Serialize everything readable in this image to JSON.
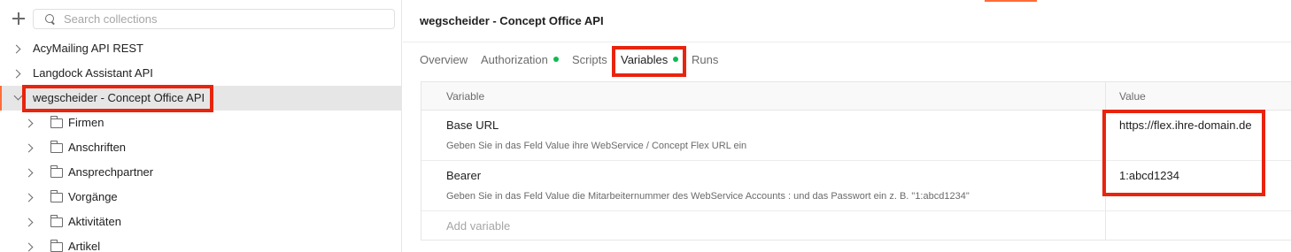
{
  "sidebar": {
    "search_placeholder": "Search collections",
    "collections": [
      {
        "label": "AcyMailing API REST"
      },
      {
        "label": "Langdock Assistant API"
      },
      {
        "label": "wegscheider - Concept Office API"
      }
    ],
    "folders": [
      {
        "label": "Firmen"
      },
      {
        "label": "Anschriften"
      },
      {
        "label": "Ansprechpartner"
      },
      {
        "label": "Vorgänge"
      },
      {
        "label": "Aktivitäten"
      },
      {
        "label": "Artikel"
      }
    ]
  },
  "main": {
    "title": "wegscheider - Concept Office API",
    "tabs": [
      {
        "label": "Overview",
        "dot": false
      },
      {
        "label": "Authorization",
        "dot": true
      },
      {
        "label": "Scripts",
        "dot": false
      },
      {
        "label": "Variables",
        "dot": true
      },
      {
        "label": "Runs",
        "dot": false
      }
    ],
    "active_tab": "Variables",
    "table": {
      "headers": {
        "variable": "Variable",
        "value": "Value"
      },
      "rows": [
        {
          "name": "Base URL",
          "description": "Geben Sie in das Feld Value ihre WebService / Concept Flex URL ein",
          "value": "https://flex.ihre-domain.de"
        },
        {
          "name": "Bearer",
          "description": "Geben Sie in das Feld Value die Mitarbeiternummer des WebService Accounts : und das Passwort ein z. B. \"1:abcd1234\"",
          "value": "1:abcd1234"
        }
      ],
      "add_placeholder": "Add variable"
    }
  },
  "colors": {
    "accent": "#ff6c37",
    "highlight_box": "#e8240e",
    "status_dot": "#0cbb52"
  }
}
